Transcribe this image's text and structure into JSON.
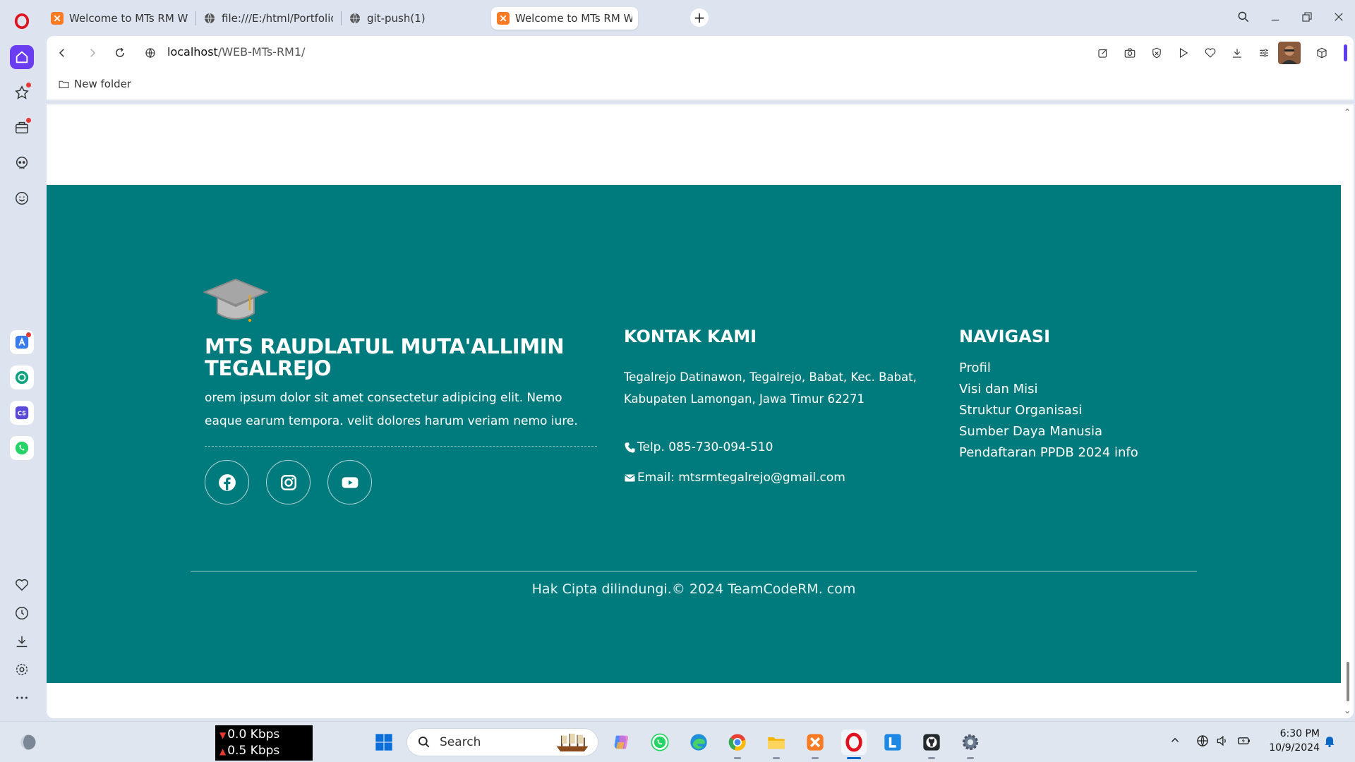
{
  "browser": {
    "tabs": [
      {
        "title": "Welcome to MTs RM Web",
        "active": false
      },
      {
        "title": "file:///E:/html/Portfolio-Ri",
        "active": false
      },
      {
        "title": "git-push(1)",
        "active": false
      },
      {
        "title": "Welcome to MTs RM Web",
        "active": true
      }
    ],
    "new_tab_label": "+",
    "url_host": "localhost",
    "url_path": "/WEB-MTs-RM1/",
    "bookmark_folder": "New folder"
  },
  "footer": {
    "school_name": "MTS RAUDLATUL MUTA'ALLIMIN TEGALREJO",
    "description": "orem ipsum dolor sit amet consectetur adipicing elit. Nemo eaque earum tempora. velit dolores harum veriam nemo iure.",
    "social": [
      {
        "name": "facebook-icon"
      },
      {
        "name": "instagram-icon"
      },
      {
        "name": "youtube-icon"
      }
    ],
    "contact_title": "KONTAK KAMI",
    "address": "Tegalrejo Datinawon, Tegalrejo, Babat, Kec. Babat, Kabupaten Lamongan, Jawa Timur 62271",
    "phone": "Telp. 085-730-094-510",
    "email": "Email: mtsrmtegalrejo@gmail.com",
    "nav_title": "NAVIGASI",
    "nav_links": [
      "Profil",
      "Visi dan Misi",
      "Struktur Organisasi",
      "Sumber Daya Manusia",
      "Pendaftaran PPDB 2024 info"
    ],
    "copyright": "Hak Cipta dilindungi.© 2024 TeamCodeRM. com",
    "bg_color": "#007b7d"
  },
  "taskbar": {
    "net_down": "0.0 Kbps",
    "net_up": "0.5 Kbps",
    "search_placeholder": "Search",
    "time": "6:30 PM",
    "date": "10/9/2024"
  }
}
